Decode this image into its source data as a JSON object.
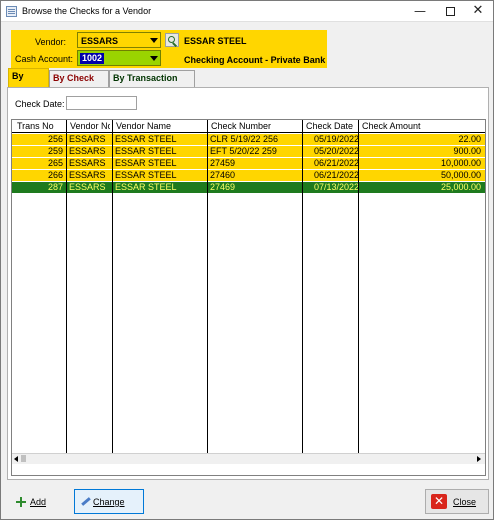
{
  "window": {
    "title": "Browse the Checks for a Vendor",
    "minimize_glyph": "—",
    "close_glyph": "✕"
  },
  "header": {
    "vendor_label": "Vendor:",
    "vendor_code": "ESSARS",
    "vendor_name": "ESSAR STEEL",
    "cash_account_label": "Cash Account:",
    "cash_account_code": "1002",
    "cash_account_name": "Checking Account - Private Bank"
  },
  "tabs": [
    {
      "label": "By Date",
      "active": true
    },
    {
      "label": "By Check No.",
      "active": false
    },
    {
      "label": "By Transaction No.",
      "active": false
    }
  ],
  "filter": {
    "check_date_label": "Check Date:",
    "check_date_value": ""
  },
  "grid": {
    "columns": [
      "Trans No",
      "Vendor No",
      "Vendor Name",
      "Check Number",
      "Check Date",
      "Check Amount"
    ],
    "rows": [
      {
        "trans_no": "256",
        "vendor_no": "ESSARS",
        "vendor_name": "ESSAR STEEL",
        "check_number": "CLR  5/19/22 256",
        "check_date": "05/19/2022",
        "check_amount": "22.00",
        "selected": false
      },
      {
        "trans_no": "259",
        "vendor_no": "ESSARS",
        "vendor_name": "ESSAR STEEL",
        "check_number": "EFT  5/20/22 259",
        "check_date": "05/20/2022",
        "check_amount": "900.00",
        "selected": false
      },
      {
        "trans_no": "265",
        "vendor_no": "ESSARS",
        "vendor_name": "ESSAR STEEL",
        "check_number": "27459",
        "check_date": "06/21/2022",
        "check_amount": "10,000.00",
        "selected": false
      },
      {
        "trans_no": "266",
        "vendor_no": "ESSARS",
        "vendor_name": "ESSAR STEEL",
        "check_number": "27460",
        "check_date": "06/21/2022",
        "check_amount": "50,000.00",
        "selected": false
      },
      {
        "trans_no": "287",
        "vendor_no": "ESSARS",
        "vendor_name": "ESSAR STEEL",
        "check_number": "27469",
        "check_date": "07/13/2022",
        "check_amount": "25,000.00",
        "selected": true
      }
    ]
  },
  "buttons": {
    "add": "Add",
    "change": "Change",
    "close": "Close"
  },
  "colors": {
    "highlight_yellow": "#ffd600",
    "selected_row": "#1e7a1e",
    "cash_account_field": "#9ad400",
    "close_icon": "#d9261c"
  }
}
